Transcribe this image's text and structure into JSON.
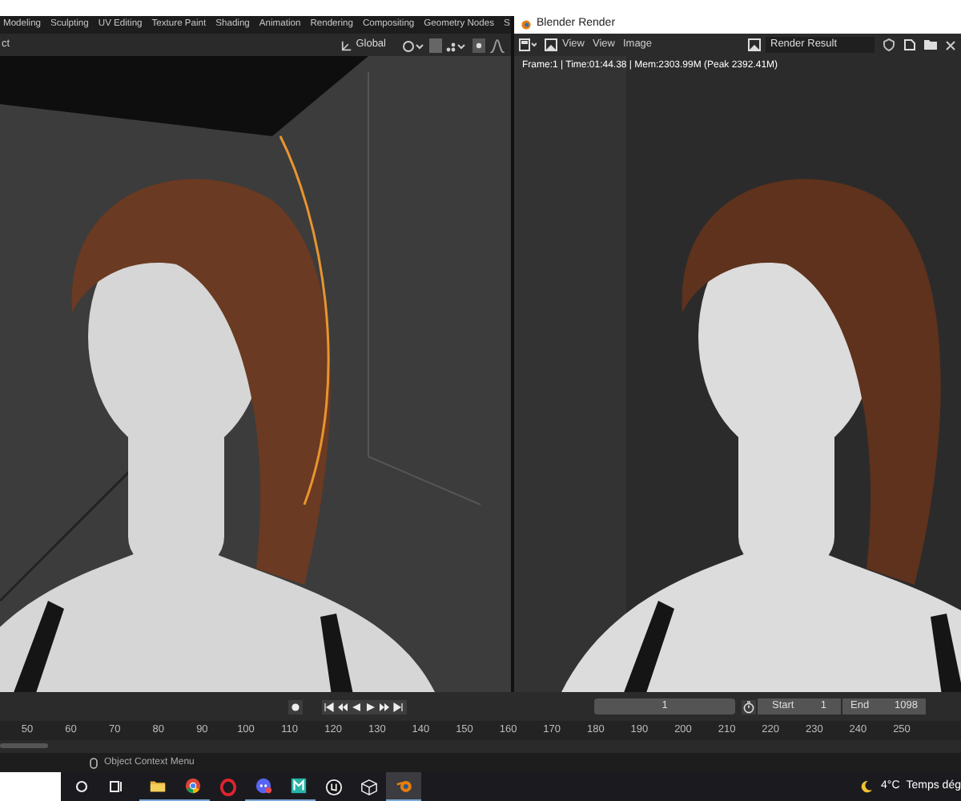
{
  "workspace_tabs": [
    "Modeling",
    "Sculpting",
    "UV Editing",
    "Texture Paint",
    "Shading",
    "Animation",
    "Rendering",
    "Compositing",
    "Geometry Nodes",
    "S"
  ],
  "viewport_header": {
    "mode_label": "ct",
    "orientation": "Global"
  },
  "render_window": {
    "title": "Blender Render",
    "menus": [
      "View",
      "View",
      "Image"
    ],
    "slot": "Render Result",
    "info": "Frame:1 | Time:01:44.38 | Mem:2303.99M (Peak 2392.41M)"
  },
  "timeline": {
    "current_frame": "1",
    "start_label": "Start",
    "start": "1",
    "end_label": "End",
    "end": "1098",
    "ruler": [
      "50",
      "60",
      "70",
      "80",
      "90",
      "100",
      "110",
      "120",
      "130",
      "140",
      "150",
      "160",
      "170",
      "180",
      "190",
      "200",
      "210",
      "220",
      "230",
      "240",
      "250"
    ]
  },
  "status_bar": {
    "hint": "Object Context Menu"
  },
  "taskbar": {
    "apps": [
      {
        "kind": "folder",
        "selected": false
      },
      {
        "kind": "chrome",
        "selected": false
      },
      {
        "kind": "opera",
        "selected": false
      },
      {
        "kind": "discord",
        "selected": false
      },
      {
        "kind": "tile",
        "selected": false
      },
      {
        "kind": "unreal",
        "selected": false
      },
      {
        "kind": "cube",
        "selected": false
      },
      {
        "kind": "blender",
        "selected": true
      }
    ],
    "temperature": "4°C",
    "weather": "Temps dég"
  }
}
